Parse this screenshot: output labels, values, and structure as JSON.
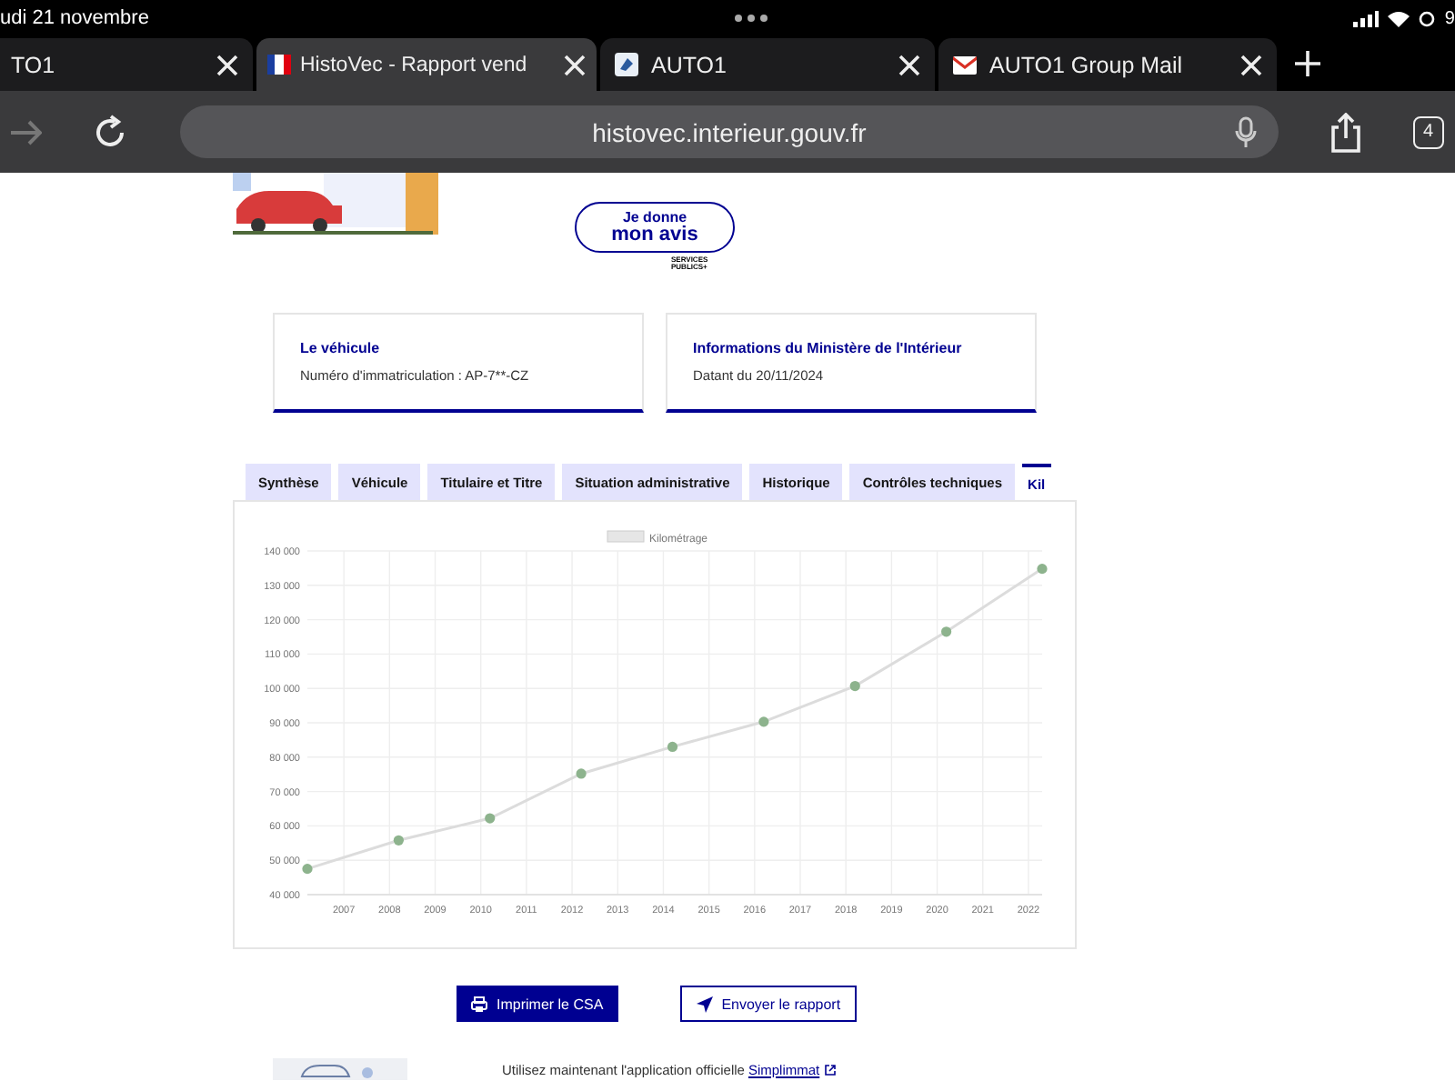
{
  "status_bar": {
    "date": "udi 21 novembre",
    "battery": "9"
  },
  "browser_tabs": [
    {
      "title": "TO1",
      "selected": false
    },
    {
      "title": "HistoVec - Rapport vend",
      "selected": true
    },
    {
      "title": "AUTO1",
      "selected": false
    },
    {
      "title": "AUTO1 Group Mail",
      "selected": false
    }
  ],
  "address_bar": {
    "url": "histovec.interieur.gouv.fr",
    "tab_count": "4"
  },
  "feedback": {
    "line1": "Je donne",
    "line2": "mon avis",
    "logo": "SERVICES PUBLICS+"
  },
  "cards": [
    {
      "title": "Le véhicule",
      "text": "Numéro d'immatriculation : AP-7**-CZ"
    },
    {
      "title": "Informations du Ministère de l'Intérieur",
      "text": "Datant du 20/11/2024"
    }
  ],
  "tabs": [
    {
      "label": "Synthèse",
      "selected": false
    },
    {
      "label": "Véhicule",
      "selected": false
    },
    {
      "label": "Titulaire et Titre",
      "selected": false
    },
    {
      "label": "Situation administrative",
      "selected": false
    },
    {
      "label": "Historique",
      "selected": false
    },
    {
      "label": "Contrôles techniques",
      "selected": false
    },
    {
      "label": "Kil",
      "selected": true
    }
  ],
  "chart_data": {
    "type": "line",
    "x": [
      2006.2,
      2008.2,
      2010.2,
      2012.2,
      2014.2,
      2016.2,
      2018.2,
      2020.2,
      2022.3
    ],
    "grid": true,
    "series": [
      {
        "name": "Kilométrage",
        "color": "#8db38d",
        "marker": "circle",
        "values": [
          47500,
          55800,
          62200,
          75200,
          83000,
          90300,
          100700,
          116500,
          134800
        ]
      }
    ],
    "xlim": [
      2006.2,
      2022.3
    ],
    "ylim": [
      40000,
      140000
    ],
    "xticks": [
      2007,
      2008,
      2009,
      2010,
      2011,
      2012,
      2013,
      2014,
      2015,
      2016,
      2017,
      2018,
      2019,
      2020,
      2021,
      2022
    ],
    "yticks": [
      {
        "value": 40000,
        "label": "40 000"
      },
      {
        "value": 50000,
        "label": "50 000"
      },
      {
        "value": 60000,
        "label": "60 000"
      },
      {
        "value": 70000,
        "label": "70 000"
      },
      {
        "value": 80000,
        "label": "80 000"
      },
      {
        "value": 90000,
        "label": "90 000"
      },
      {
        "value": 100000,
        "label": "100 000"
      },
      {
        "value": 110000,
        "label": "110 000"
      },
      {
        "value": 120000,
        "label": "120 000"
      },
      {
        "value": 130000,
        "label": "130 000"
      },
      {
        "value": 140000,
        "label": "140 000"
      }
    ]
  },
  "actions": [
    {
      "label": "Imprimer le CSA",
      "kind": "primary"
    },
    {
      "label": "Envoyer le rapport",
      "kind": "secondary"
    }
  ],
  "promo": {
    "text": "Utilisez maintenant l'application officielle",
    "link": "Simplimmat"
  }
}
